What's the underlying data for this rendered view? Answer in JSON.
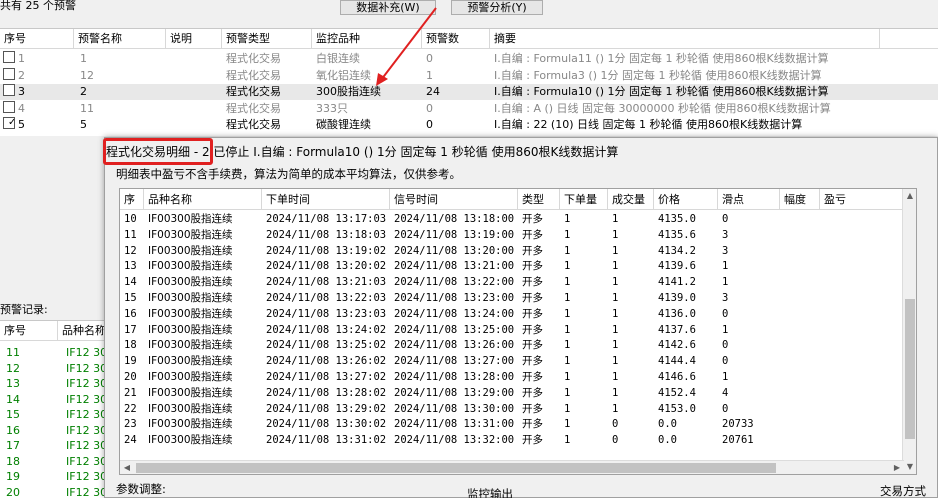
{
  "top": {
    "alert_count": "共有 25 个预警",
    "btn_supplement": "数据补充(W)",
    "btn_analysis": "预警分析(Y)"
  },
  "alert_table": {
    "headers": [
      "序号",
      "预警名称",
      "说明",
      "预警类型",
      "监控品种",
      "预警数",
      "摘要"
    ],
    "rows": [
      {
        "checked": false,
        "dim": true,
        "selected": false,
        "seq": "1",
        "name": "1",
        "desc": "",
        "type": "程式化交易",
        "variety": "白银连续",
        "count": "0",
        "summary": "I.自编 : Formula11 () 1分 固定每 1 秒轮循 使用860根K线数据计算"
      },
      {
        "checked": false,
        "dim": true,
        "selected": false,
        "seq": "2",
        "name": "12",
        "desc": "",
        "type": "程式化交易",
        "variety": "氧化铝连续",
        "count": "1",
        "summary": "I.自编 : Formula3 () 1分 固定每 1 秒轮循 使用860根K线数据计算"
      },
      {
        "checked": false,
        "dim": false,
        "selected": true,
        "seq": "3",
        "name": "2",
        "desc": "",
        "type": "程式化交易",
        "variety": "300股指连续",
        "count": "24",
        "summary": "I.自编 : Formula10 () 1分 固定每 1 秒轮循 使用860根K线数据计算"
      },
      {
        "checked": false,
        "dim": true,
        "selected": false,
        "seq": "4",
        "name": "11",
        "desc": "",
        "type": "程式化交易",
        "variety": "333只",
        "count": "0",
        "summary": "I.自编 : A () 日线 固定每 30000000 秒轮循 使用860根K线数据计算"
      },
      {
        "checked": true,
        "dim": false,
        "selected": false,
        "seq": "5",
        "name": "5",
        "desc": "",
        "type": "程式化交易",
        "variety": "碳酸锂连续",
        "count": "0",
        "summary": "I.自编 : 22 (10) 日线 固定每 1 秒轮循 使用860根K线数据计算"
      }
    ]
  },
  "record": {
    "label": "预警记录:",
    "headers": [
      "序号",
      "品种名称"
    ],
    "rows": [
      {
        "seq": "11",
        "name": "IF12 30"
      },
      {
        "seq": "12",
        "name": "IF12 30"
      },
      {
        "seq": "13",
        "name": "IF12 30"
      },
      {
        "seq": "14",
        "name": "IF12 30"
      },
      {
        "seq": "15",
        "name": "IF12 30"
      },
      {
        "seq": "16",
        "name": "IF12 30"
      },
      {
        "seq": "17",
        "name": "IF12 30"
      },
      {
        "seq": "18",
        "name": "IF12 30"
      },
      {
        "seq": "19",
        "name": "IF12 30"
      },
      {
        "seq": "20",
        "name": "IF12 30"
      }
    ]
  },
  "dialog": {
    "title_prefix": "程式化交易明细 - 2",
    "title_rest": " 已停止  I.自编 : Formula10 () 1分 固定每 1 秒轮循 使用860根K线数据计算",
    "note": "明细表中盈亏不含手续费，算法为简单的成本平均算法，仅供参考。",
    "headers": [
      "序",
      "品种名称",
      "下单时间",
      "信号时间",
      "类型",
      "下单量",
      "成交量",
      "价格",
      "滑点",
      "幅度",
      "盈亏"
    ],
    "rows": [
      {
        "seq": "10",
        "name": "IF00300股指连续",
        "order_time": "2024/11/08 13:17:03",
        "signal_time": "2024/11/08 13:18:00",
        "type": "开多",
        "qty": "1",
        "filled": "1",
        "price": "4135.0",
        "slip": "0",
        "amp": "",
        "pnl": ""
      },
      {
        "seq": "11",
        "name": "IF00300股指连续",
        "order_time": "2024/11/08 13:18:03",
        "signal_time": "2024/11/08 13:19:00",
        "type": "开多",
        "qty": "1",
        "filled": "1",
        "price": "4135.6",
        "slip": "3",
        "amp": "",
        "pnl": ""
      },
      {
        "seq": "12",
        "name": "IF00300股指连续",
        "order_time": "2024/11/08 13:19:02",
        "signal_time": "2024/11/08 13:20:00",
        "type": "开多",
        "qty": "1",
        "filled": "1",
        "price": "4134.2",
        "slip": "3",
        "amp": "",
        "pnl": ""
      },
      {
        "seq": "13",
        "name": "IF00300股指连续",
        "order_time": "2024/11/08 13:20:02",
        "signal_time": "2024/11/08 13:21:00",
        "type": "开多",
        "qty": "1",
        "filled": "1",
        "price": "4139.6",
        "slip": "1",
        "amp": "",
        "pnl": ""
      },
      {
        "seq": "14",
        "name": "IF00300股指连续",
        "order_time": "2024/11/08 13:21:03",
        "signal_time": "2024/11/08 13:22:00",
        "type": "开多",
        "qty": "1",
        "filled": "1",
        "price": "4141.2",
        "slip": "1",
        "amp": "",
        "pnl": ""
      },
      {
        "seq": "15",
        "name": "IF00300股指连续",
        "order_time": "2024/11/08 13:22:03",
        "signal_time": "2024/11/08 13:23:00",
        "type": "开多",
        "qty": "1",
        "filled": "1",
        "price": "4139.0",
        "slip": "3",
        "amp": "",
        "pnl": ""
      },
      {
        "seq": "16",
        "name": "IF00300股指连续",
        "order_time": "2024/11/08 13:23:03",
        "signal_time": "2024/11/08 13:24:00",
        "type": "开多",
        "qty": "1",
        "filled": "1",
        "price": "4136.0",
        "slip": "0",
        "amp": "",
        "pnl": ""
      },
      {
        "seq": "17",
        "name": "IF00300股指连续",
        "order_time": "2024/11/08 13:24:02",
        "signal_time": "2024/11/08 13:25:00",
        "type": "开多",
        "qty": "1",
        "filled": "1",
        "price": "4137.6",
        "slip": "1",
        "amp": "",
        "pnl": ""
      },
      {
        "seq": "18",
        "name": "IF00300股指连续",
        "order_time": "2024/11/08 13:25:02",
        "signal_time": "2024/11/08 13:26:00",
        "type": "开多",
        "qty": "1",
        "filled": "1",
        "price": "4142.6",
        "slip": "0",
        "amp": "",
        "pnl": ""
      },
      {
        "seq": "19",
        "name": "IF00300股指连续",
        "order_time": "2024/11/08 13:26:02",
        "signal_time": "2024/11/08 13:27:00",
        "type": "开多",
        "qty": "1",
        "filled": "1",
        "price": "4144.4",
        "slip": "0",
        "amp": "",
        "pnl": ""
      },
      {
        "seq": "20",
        "name": "IF00300股指连续",
        "order_time": "2024/11/08 13:27:02",
        "signal_time": "2024/11/08 13:28:00",
        "type": "开多",
        "qty": "1",
        "filled": "1",
        "price": "4146.6",
        "slip": "1",
        "amp": "",
        "pnl": ""
      },
      {
        "seq": "21",
        "name": "IF00300股指连续",
        "order_time": "2024/11/08 13:28:02",
        "signal_time": "2024/11/08 13:29:00",
        "type": "开多",
        "qty": "1",
        "filled": "1",
        "price": "4152.4",
        "slip": "4",
        "amp": "",
        "pnl": ""
      },
      {
        "seq": "22",
        "name": "IF00300股指连续",
        "order_time": "2024/11/08 13:29:02",
        "signal_time": "2024/11/08 13:30:00",
        "type": "开多",
        "qty": "1",
        "filled": "1",
        "price": "4153.0",
        "slip": "0",
        "amp": "",
        "pnl": ""
      },
      {
        "seq": "23",
        "name": "IF00300股指连续",
        "order_time": "2024/11/08 13:30:02",
        "signal_time": "2024/11/08 13:31:00",
        "type": "开多",
        "qty": "1",
        "filled": "0",
        "price": "0.0",
        "slip": "20733",
        "amp": "",
        "pnl": ""
      },
      {
        "seq": "24",
        "name": "IF00300股指连续",
        "order_time": "2024/11/08 13:31:02",
        "signal_time": "2024/11/08 13:32:00",
        "type": "开多",
        "qty": "1",
        "filled": "0",
        "price": "0.0",
        "slip": "20761",
        "amp": "",
        "pnl": ""
      }
    ],
    "param_label": "参数调整:",
    "monitor_label": "监控输出"
  },
  "footer": {
    "trade_mode": "交易方式"
  },
  "colors": {
    "highlight_border": "#e02020",
    "record_text": "#008000",
    "dim_text": "#888888"
  }
}
